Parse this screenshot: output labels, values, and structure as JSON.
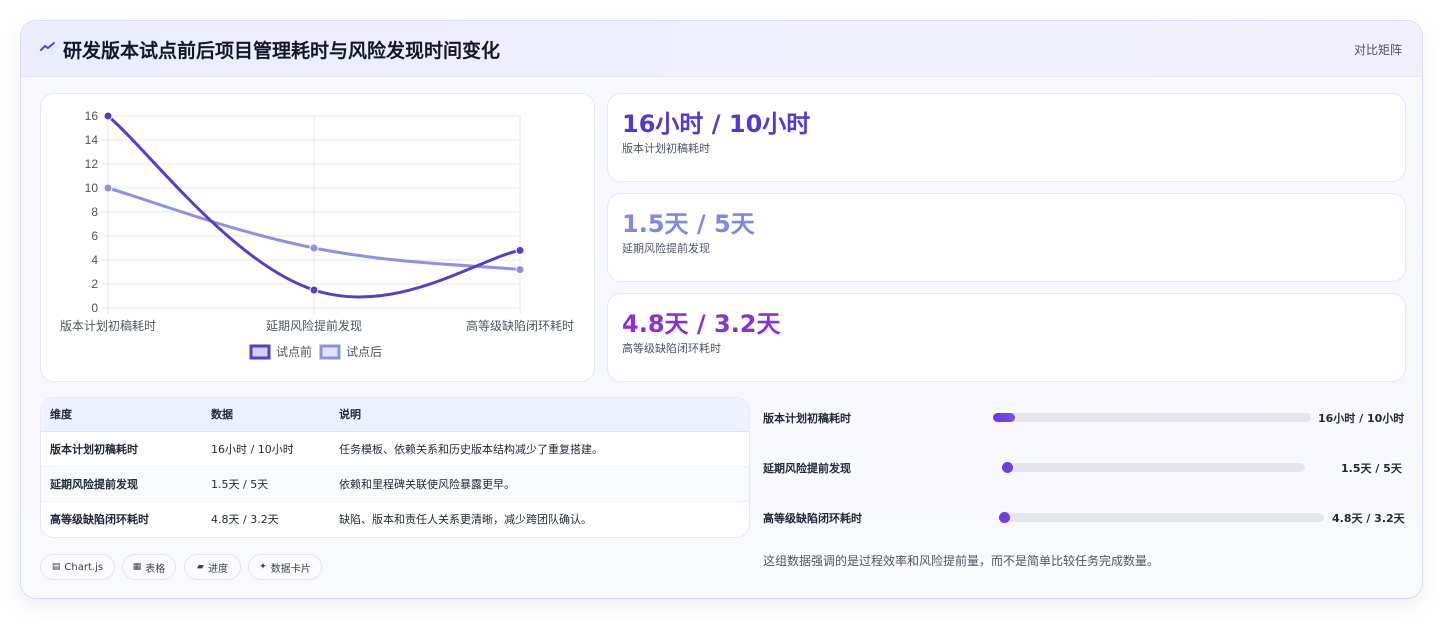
{
  "header": {
    "icon": "trend-icon",
    "title": "研发版本试点前后项目管理耗时与风险发现时间变化",
    "right_label": "对比矩阵"
  },
  "chart_data": {
    "type": "line",
    "categories": [
      "版本计划初稿耗时",
      "延期风险提前发现",
      "高等级缺陷闭环耗时"
    ],
    "series": [
      {
        "name": "试点前",
        "values": [
          16,
          1.5,
          4.8
        ],
        "color": "#5141c9"
      },
      {
        "name": "试点后",
        "values": [
          10,
          5,
          3.2
        ],
        "color": "#8b91e4"
      }
    ],
    "ylim": [
      0,
      16
    ],
    "yticks": [
      0,
      2,
      4,
      6,
      8,
      10,
      12,
      14,
      16
    ],
    "grid": true,
    "legend_position": "bottom"
  },
  "stats": [
    {
      "value": "16小时 / 10小时",
      "label": "版本计划初稿耗时",
      "color": "#4f3bd0"
    },
    {
      "value": "1.5天 / 5天",
      "label": "延期风险提前发现",
      "color": "#7f88e6"
    },
    {
      "value": "4.8天 / 3.2天",
      "label": "高等级缺陷闭环耗时",
      "color": "#8b2fd6"
    }
  ],
  "table": {
    "headers": [
      "维度",
      "数据",
      "说明"
    ],
    "rows": [
      [
        "版本计划初稿耗时",
        "16小时 / 10小时",
        "任务模板、依赖关系和历史版本结构减少了重复搭建。"
      ],
      [
        "延期风险提前发现",
        "1.5天 / 5天",
        "依赖和里程碑关联使风险暴露更早。"
      ],
      [
        "高等级缺陷闭环耗时",
        "4.8天 / 3.2天",
        "缺陷、版本和责任人关系更清晰，减少跨团队确认。"
      ]
    ]
  },
  "chips": [
    {
      "icon": "▤",
      "label": "Chart.js"
    },
    {
      "icon": "▦",
      "label": "表格"
    },
    {
      "icon": "▰",
      "label": "进度"
    },
    {
      "icon": "✦",
      "label": "数据卡片"
    }
  ],
  "progress": [
    {
      "label": "版本计划初稿耗时",
      "value": "16小时 / 10小时",
      "fraction": 0.07
    },
    {
      "label": "延期风险提前发现",
      "value": "1.5天 / 5天",
      "fraction": 0.01
    },
    {
      "label": "高等级缺陷闭环耗时",
      "value": "4.8天 / 3.2天",
      "fraction": 0.01
    }
  ],
  "note": "这组数据强调的是过程效率和风险提前量，而不是简单比较任务完成数量。"
}
